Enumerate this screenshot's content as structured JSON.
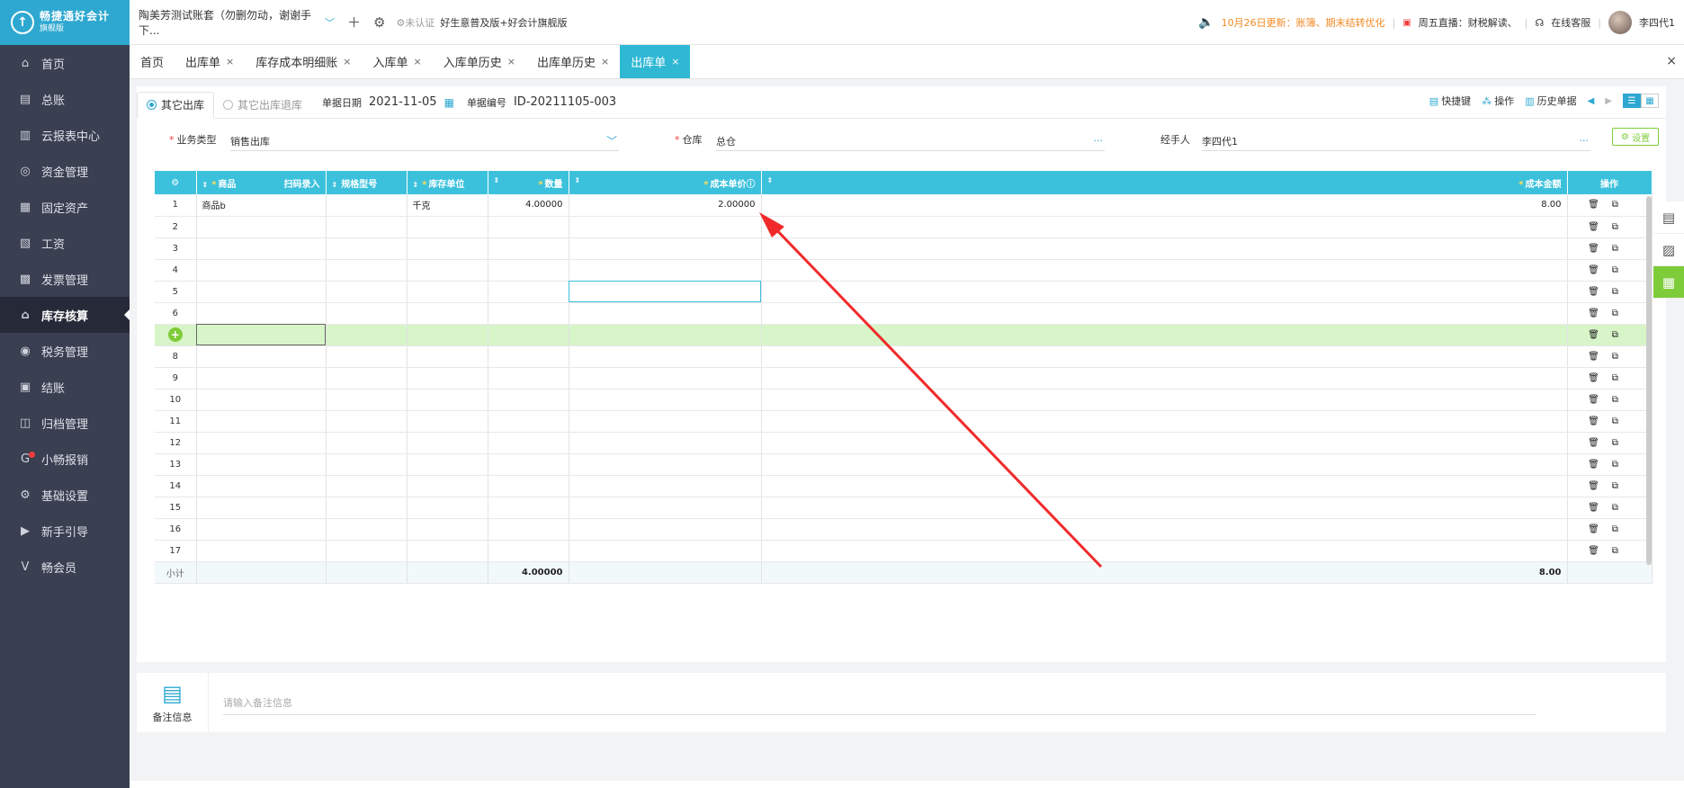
{
  "app": {
    "logo_line1": "畅捷通好会计",
    "logo_line2": "旗舰版",
    "account_name": "陶美芳测试账套（勿删勿动，谢谢手下...",
    "cert_status": "未认证",
    "edition": "好生意普及版+好会计旗舰版",
    "notice": "10月26日更新：账簿、期末结转优化",
    "live": "周五直播：财税解读、",
    "service": "在线客服",
    "user": "李四代1"
  },
  "sidebar": {
    "items": [
      {
        "label": "首页",
        "icon": "home-icon",
        "glyph": "⌂"
      },
      {
        "label": "总账",
        "icon": "ledger-icon",
        "glyph": "▤"
      },
      {
        "label": "云报表中心",
        "icon": "chart-icon",
        "glyph": "▥"
      },
      {
        "label": "资金管理",
        "icon": "money-icon",
        "glyph": "◎"
      },
      {
        "label": "固定资产",
        "icon": "asset-icon",
        "glyph": "▦"
      },
      {
        "label": "工资",
        "icon": "salary-icon",
        "glyph": "▧"
      },
      {
        "label": "发票管理",
        "icon": "invoice-icon",
        "glyph": "▩"
      },
      {
        "label": "库存核算",
        "icon": "inventory-icon",
        "glyph": "⌂"
      },
      {
        "label": "税务管理",
        "icon": "tax-icon",
        "glyph": "◉"
      },
      {
        "label": "结账",
        "icon": "close-account-icon",
        "glyph": "▣"
      },
      {
        "label": "归档管理",
        "icon": "archive-icon",
        "glyph": "◫"
      },
      {
        "label": "小畅报销",
        "icon": "reimburse-icon",
        "glyph": "G"
      },
      {
        "label": "基础设置",
        "icon": "settings-icon",
        "glyph": "⚙"
      },
      {
        "label": "新手引导",
        "icon": "guide-icon",
        "glyph": "▶"
      },
      {
        "label": "畅会员",
        "icon": "member-icon",
        "glyph": "V"
      }
    ]
  },
  "tabs": [
    {
      "label": "首页",
      "closable": false
    },
    {
      "label": "出库单",
      "closable": true
    },
    {
      "label": "库存成本明细账",
      "closable": true
    },
    {
      "label": "入库单",
      "closable": true
    },
    {
      "label": "入库单历史",
      "closable": true
    },
    {
      "label": "出库单历史",
      "closable": true
    },
    {
      "label": "出库单",
      "closable": true
    }
  ],
  "tab_close": "×",
  "doc": {
    "subtab_active": "其它出库",
    "subtab_other": "其它出库退库",
    "date_label": "单据日期",
    "date_value": "2021-11-05",
    "no_label": "单据编号",
    "no_value": "ID-20211105-003",
    "tool_shortcut": "快捷键",
    "tool_ops": "操作",
    "tool_history": "历史单据"
  },
  "form": {
    "biz_type_label": "业务类型",
    "biz_type_value": "销售出库",
    "warehouse_label": "仓库",
    "warehouse_value": "总仓",
    "handler_label": "经手人",
    "handler_value": "李四代1",
    "settings_label": "设置"
  },
  "grid": {
    "headers": {
      "product": "商品",
      "scan": "扫码录入",
      "spec": "规格型号",
      "unit": "库存单位",
      "qty": "数量",
      "price": "成本单价",
      "amount": "成本金额",
      "ops": "操作"
    },
    "rows": [
      {
        "no": "1",
        "product": "商品b",
        "spec": "",
        "unit": "千克",
        "qty": "4.00000",
        "price": "2.00000",
        "amount": "8.00"
      },
      {
        "no": "2",
        "product": "",
        "spec": "",
        "unit": "",
        "qty": "",
        "price": "",
        "amount": ""
      },
      {
        "no": "3",
        "product": "",
        "spec": "",
        "unit": "",
        "qty": "",
        "price": "",
        "amount": ""
      },
      {
        "no": "4",
        "product": "",
        "spec": "",
        "unit": "",
        "qty": "",
        "price": "",
        "amount": ""
      },
      {
        "no": "5",
        "product": "",
        "spec": "",
        "unit": "",
        "qty": "",
        "price": "",
        "amount": ""
      },
      {
        "no": "6",
        "product": "",
        "spec": "",
        "unit": "",
        "qty": "",
        "price": "",
        "amount": ""
      },
      {
        "no": "+",
        "product": "",
        "spec": "",
        "unit": "",
        "qty": "",
        "price": "",
        "amount": ""
      },
      {
        "no": "8",
        "product": "",
        "spec": "",
        "unit": "",
        "qty": "",
        "price": "",
        "amount": ""
      },
      {
        "no": "9",
        "product": "",
        "spec": "",
        "unit": "",
        "qty": "",
        "price": "",
        "amount": ""
      },
      {
        "no": "10",
        "product": "",
        "spec": "",
        "unit": "",
        "qty": "",
        "price": "",
        "amount": ""
      },
      {
        "no": "11",
        "product": "",
        "spec": "",
        "unit": "",
        "qty": "",
        "price": "",
        "amount": ""
      },
      {
        "no": "12",
        "product": "",
        "spec": "",
        "unit": "",
        "qty": "",
        "price": "",
        "amount": ""
      },
      {
        "no": "13",
        "product": "",
        "spec": "",
        "unit": "",
        "qty": "",
        "price": "",
        "amount": ""
      },
      {
        "no": "14",
        "product": "",
        "spec": "",
        "unit": "",
        "qty": "",
        "price": "",
        "amount": ""
      },
      {
        "no": "15",
        "product": "",
        "spec": "",
        "unit": "",
        "qty": "",
        "price": "",
        "amount": ""
      },
      {
        "no": "16",
        "product": "",
        "spec": "",
        "unit": "",
        "qty": "",
        "price": "",
        "amount": ""
      },
      {
        "no": "17",
        "product": "",
        "spec": "",
        "unit": "",
        "qty": "",
        "price": "",
        "amount": ""
      }
    ],
    "subtotal_label": "小计",
    "subtotal_qty": "4.00000",
    "subtotal_amount": "8.00"
  },
  "remarks": {
    "label": "备注信息",
    "placeholder": "请输入备注信息"
  },
  "colors": {
    "accent": "#2ea8d1",
    "header": "#3cc1dc",
    "green": "#7fcc3a",
    "arrow": "#f02a2a"
  }
}
